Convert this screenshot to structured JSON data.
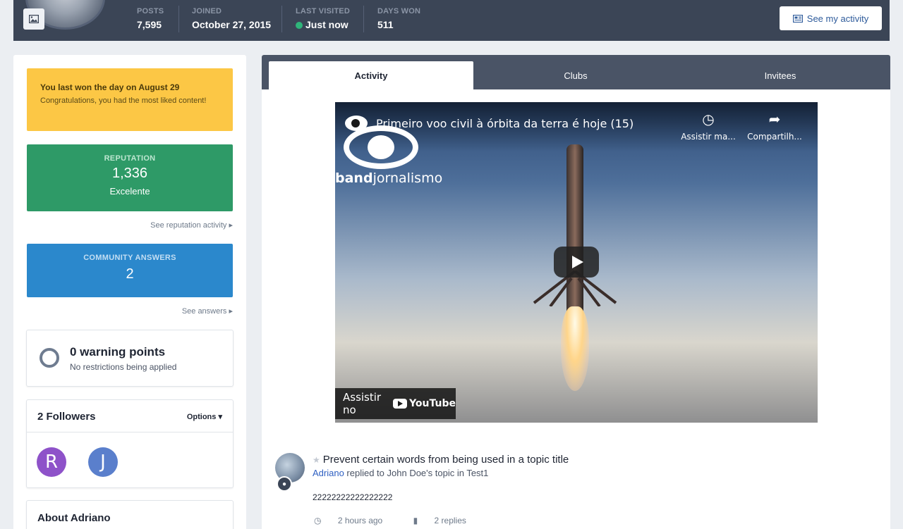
{
  "header": {
    "stats": [
      {
        "label": "POSTS",
        "value": "7,595"
      },
      {
        "label": "JOINED",
        "value": "October 27, 2015"
      },
      {
        "label": "LAST VISITED",
        "value": "Just now"
      },
      {
        "label": "DAYS WON",
        "value": "511"
      }
    ],
    "activity_button": "See my activity",
    "online_color": "#2fb57a"
  },
  "sidebar": {
    "won_title": "You last won the day on August 29",
    "won_text": "Congratulations, you had the most liked content!",
    "reputation_label": "REPUTATION",
    "reputation_value": "1,336",
    "reputation_desc": "Excelente",
    "reputation_link": "See reputation activity",
    "answers_label": "COMMUNITY ANSWERS",
    "answers_value": "2",
    "answers_link": "See answers",
    "warning_title": "0 warning points",
    "warning_text": "No restrictions being applied",
    "followers_title": "2 Followers",
    "followers_options": "Options",
    "followers": [
      {
        "initial": "R",
        "color": "#8e52c9"
      },
      {
        "initial": "J",
        "color": "#5a7fcc"
      }
    ],
    "about_title": "About Adriano"
  },
  "tabs": [
    "Activity",
    "Clubs",
    "Invitees"
  ],
  "video": {
    "title": "Primeiro voo civil à órbita da terra é hoje (15)",
    "brand_bold": "band",
    "brand_rest": "jornalismo",
    "watch_later": "Assistir ma...",
    "share": "Compartilh...",
    "watch_on": "Assistir no",
    "youtube": "YouTube"
  },
  "post": {
    "title": "Prevent certain words from being used in a topic title",
    "author": "Adriano",
    "meta_rest": " replied to John Doe's topic in Test1",
    "body": "22222222222222222",
    "time": "2 hours ago",
    "replies": "2 replies"
  }
}
